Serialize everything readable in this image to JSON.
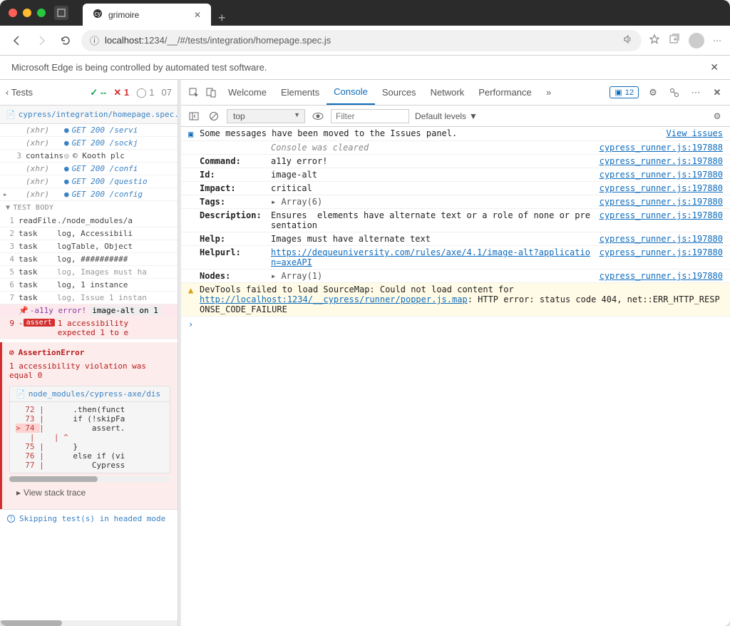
{
  "window": {
    "tab_title": "grimoire"
  },
  "toolbar": {
    "url_prefix": "localhost:",
    "url_rest": "1234/__/#/tests/integration/homepage.spec.js"
  },
  "info_bar": "Microsoft Edge is being controlled by automated test software.",
  "left": {
    "tests_label": "Tests",
    "pass_dash": "--",
    "fail_count": "1",
    "pend_count": "1",
    "num": "07",
    "spec_path": "cypress/integration/homepage.spec.js",
    "xhr_rows": [
      {
        "num": "",
        "type": "(xhr)",
        "msg": "GET 200 /servi",
        "dot": true
      },
      {
        "num": "",
        "type": "(xhr)",
        "msg": "GET 200 /sockj",
        "dot": true
      },
      {
        "num": "3",
        "type": "contains",
        "msg": "© Kooth plc",
        "dark": true
      },
      {
        "num": "",
        "type": "(xhr)",
        "msg": "GET 200 /confi",
        "dot": true
      },
      {
        "num": "",
        "type": "(xhr)",
        "msg": "GET 200 /questio",
        "dot": true
      },
      {
        "num": "",
        "type": "(xhr)",
        "msg": "GET 200 /config",
        "dot": true,
        "arrow": true
      }
    ],
    "test_body_label": "TEST BODY",
    "test_body": [
      {
        "num": "1",
        "type": "readFile",
        "msg": "./node_modules/a"
      },
      {
        "num": "2",
        "type": "task",
        "msg": "log, Accessibili"
      },
      {
        "num": "3",
        "type": "task",
        "msg": "logTable, Object"
      },
      {
        "num": "4",
        "type": "task",
        "msg": "log, ##########"
      },
      {
        "num": "5",
        "type": "task",
        "msg": "log, Images must ha",
        "grey": true
      },
      {
        "num": "6",
        "type": "task",
        "msg": "log, 1 instance"
      },
      {
        "num": "7",
        "type": "task",
        "msg": "log, Issue 1 instan",
        "grey": true
      }
    ],
    "a11y_row": {
      "label": "-a11y error!",
      "msg": "image-alt on 1"
    },
    "assert_row": {
      "num": "9",
      "badge": "assert",
      "msg1": "1 accessibility",
      "msg2": "expected 1 to e"
    },
    "assertion": {
      "title": "AssertionError",
      "msg": "1 accessibility violation was\nequal 0",
      "file": "node_modules/cypress-axe/dis",
      "lines": [
        {
          "ln": "72",
          "tx": "       .then(funct"
        },
        {
          "ln": "73",
          "tx": "       if (!skipFa"
        },
        {
          "ln": "74",
          "tx": "           assert.",
          "hl": true,
          "pre": "> "
        },
        {
          "ln": "",
          "tx": "   | ^",
          "caret": true
        },
        {
          "ln": "75",
          "tx": "       }"
        },
        {
          "ln": "76",
          "tx": "       else if (vi"
        },
        {
          "ln": "77",
          "tx": "           Cypress"
        }
      ],
      "stack": "View stack trace"
    },
    "skip_note": "Skipping test(s) in headed mode"
  },
  "devtools": {
    "tabs": [
      "Welcome",
      "Elements",
      "Console",
      "Sources",
      "Network",
      "Performance"
    ],
    "active_tab": "Console",
    "issues_count": "12",
    "context": "top",
    "filter_placeholder": "Filter",
    "levels": "Default levels",
    "issues_msg": "Some messages have been moved to the Issues panel.",
    "view_issues": "View issues",
    "rows": [
      {
        "label": "",
        "val": "Console was cleared",
        "italic": true,
        "link": "cypress_runner.js:197888"
      },
      {
        "label": "Command:",
        "val": "a11y error!",
        "link": "cypress_runner.js:197880"
      },
      {
        "label": "Id:",
        "val": "image-alt",
        "link": "cypress_runner.js:197880"
      },
      {
        "label": "Impact:",
        "val": "critical",
        "link": "cypress_runner.js:197880"
      },
      {
        "label": "Tags:",
        "val": "Array(6)",
        "expand": true,
        "link": "cypress_runner.js:197880"
      },
      {
        "label": "Description:",
        "val": "Ensures <img> elements have alternate text or a role of none or presentation",
        "link": "cypress_runner.js:197880"
      },
      {
        "label": "Help:",
        "val": "Images must have alternate text",
        "link": "cypress_runner.js:197880"
      },
      {
        "label": "Helpurl:",
        "val_link": "https://dequeuniversity.com/rules/axe/4.1/image-alt?application=axeAPI",
        "link": "cypress_runner.js:197880"
      },
      {
        "label": "Nodes:",
        "val": "Array(1)",
        "expand": true,
        "link": "cypress_runner.js:197880"
      }
    ],
    "warn": {
      "pre": "DevTools failed to load SourceMap: Could not load content for ",
      "url": "http://localhost:1234/__cypress/runner/popper.js.map",
      "post": ": HTTP error: status code 404, net::ERR_HTTP_RESPONSE_CODE_FAILURE"
    }
  }
}
